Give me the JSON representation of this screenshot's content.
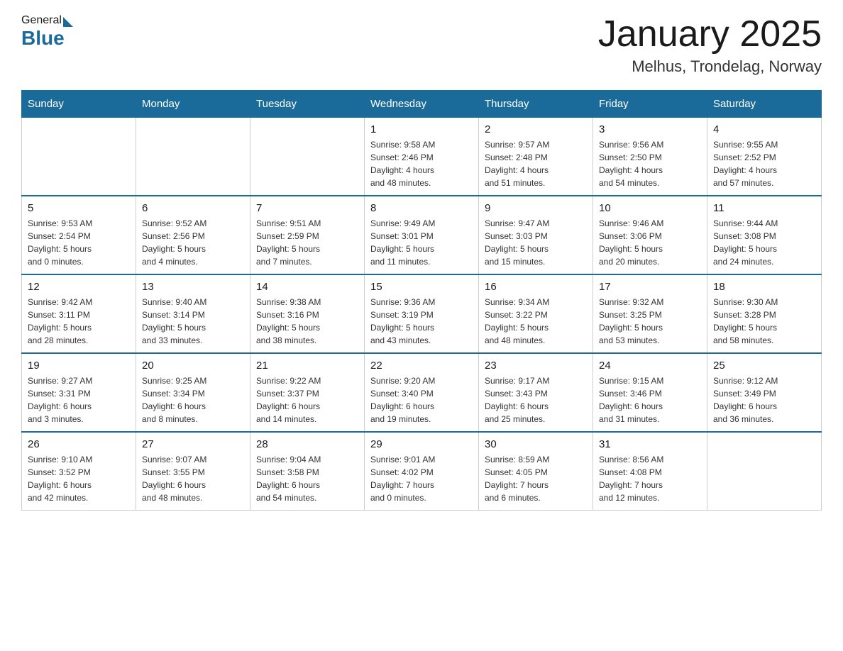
{
  "header": {
    "logo_general": "General",
    "logo_blue": "Blue",
    "month": "January 2025",
    "location": "Melhus, Trondelag, Norway"
  },
  "weekdays": [
    "Sunday",
    "Monday",
    "Tuesday",
    "Wednesday",
    "Thursday",
    "Friday",
    "Saturday"
  ],
  "weeks": [
    [
      {
        "day": "",
        "info": ""
      },
      {
        "day": "",
        "info": ""
      },
      {
        "day": "",
        "info": ""
      },
      {
        "day": "1",
        "info": "Sunrise: 9:58 AM\nSunset: 2:46 PM\nDaylight: 4 hours\nand 48 minutes."
      },
      {
        "day": "2",
        "info": "Sunrise: 9:57 AM\nSunset: 2:48 PM\nDaylight: 4 hours\nand 51 minutes."
      },
      {
        "day": "3",
        "info": "Sunrise: 9:56 AM\nSunset: 2:50 PM\nDaylight: 4 hours\nand 54 minutes."
      },
      {
        "day": "4",
        "info": "Sunrise: 9:55 AM\nSunset: 2:52 PM\nDaylight: 4 hours\nand 57 minutes."
      }
    ],
    [
      {
        "day": "5",
        "info": "Sunrise: 9:53 AM\nSunset: 2:54 PM\nDaylight: 5 hours\nand 0 minutes."
      },
      {
        "day": "6",
        "info": "Sunrise: 9:52 AM\nSunset: 2:56 PM\nDaylight: 5 hours\nand 4 minutes."
      },
      {
        "day": "7",
        "info": "Sunrise: 9:51 AM\nSunset: 2:59 PM\nDaylight: 5 hours\nand 7 minutes."
      },
      {
        "day": "8",
        "info": "Sunrise: 9:49 AM\nSunset: 3:01 PM\nDaylight: 5 hours\nand 11 minutes."
      },
      {
        "day": "9",
        "info": "Sunrise: 9:47 AM\nSunset: 3:03 PM\nDaylight: 5 hours\nand 15 minutes."
      },
      {
        "day": "10",
        "info": "Sunrise: 9:46 AM\nSunset: 3:06 PM\nDaylight: 5 hours\nand 20 minutes."
      },
      {
        "day": "11",
        "info": "Sunrise: 9:44 AM\nSunset: 3:08 PM\nDaylight: 5 hours\nand 24 minutes."
      }
    ],
    [
      {
        "day": "12",
        "info": "Sunrise: 9:42 AM\nSunset: 3:11 PM\nDaylight: 5 hours\nand 28 minutes."
      },
      {
        "day": "13",
        "info": "Sunrise: 9:40 AM\nSunset: 3:14 PM\nDaylight: 5 hours\nand 33 minutes."
      },
      {
        "day": "14",
        "info": "Sunrise: 9:38 AM\nSunset: 3:16 PM\nDaylight: 5 hours\nand 38 minutes."
      },
      {
        "day": "15",
        "info": "Sunrise: 9:36 AM\nSunset: 3:19 PM\nDaylight: 5 hours\nand 43 minutes."
      },
      {
        "day": "16",
        "info": "Sunrise: 9:34 AM\nSunset: 3:22 PM\nDaylight: 5 hours\nand 48 minutes."
      },
      {
        "day": "17",
        "info": "Sunrise: 9:32 AM\nSunset: 3:25 PM\nDaylight: 5 hours\nand 53 minutes."
      },
      {
        "day": "18",
        "info": "Sunrise: 9:30 AM\nSunset: 3:28 PM\nDaylight: 5 hours\nand 58 minutes."
      }
    ],
    [
      {
        "day": "19",
        "info": "Sunrise: 9:27 AM\nSunset: 3:31 PM\nDaylight: 6 hours\nand 3 minutes."
      },
      {
        "day": "20",
        "info": "Sunrise: 9:25 AM\nSunset: 3:34 PM\nDaylight: 6 hours\nand 8 minutes."
      },
      {
        "day": "21",
        "info": "Sunrise: 9:22 AM\nSunset: 3:37 PM\nDaylight: 6 hours\nand 14 minutes."
      },
      {
        "day": "22",
        "info": "Sunrise: 9:20 AM\nSunset: 3:40 PM\nDaylight: 6 hours\nand 19 minutes."
      },
      {
        "day": "23",
        "info": "Sunrise: 9:17 AM\nSunset: 3:43 PM\nDaylight: 6 hours\nand 25 minutes."
      },
      {
        "day": "24",
        "info": "Sunrise: 9:15 AM\nSunset: 3:46 PM\nDaylight: 6 hours\nand 31 minutes."
      },
      {
        "day": "25",
        "info": "Sunrise: 9:12 AM\nSunset: 3:49 PM\nDaylight: 6 hours\nand 36 minutes."
      }
    ],
    [
      {
        "day": "26",
        "info": "Sunrise: 9:10 AM\nSunset: 3:52 PM\nDaylight: 6 hours\nand 42 minutes."
      },
      {
        "day": "27",
        "info": "Sunrise: 9:07 AM\nSunset: 3:55 PM\nDaylight: 6 hours\nand 48 minutes."
      },
      {
        "day": "28",
        "info": "Sunrise: 9:04 AM\nSunset: 3:58 PM\nDaylight: 6 hours\nand 54 minutes."
      },
      {
        "day": "29",
        "info": "Sunrise: 9:01 AM\nSunset: 4:02 PM\nDaylight: 7 hours\nand 0 minutes."
      },
      {
        "day": "30",
        "info": "Sunrise: 8:59 AM\nSunset: 4:05 PM\nDaylight: 7 hours\nand 6 minutes."
      },
      {
        "day": "31",
        "info": "Sunrise: 8:56 AM\nSunset: 4:08 PM\nDaylight: 7 hours\nand 12 minutes."
      },
      {
        "day": "",
        "info": ""
      }
    ]
  ]
}
